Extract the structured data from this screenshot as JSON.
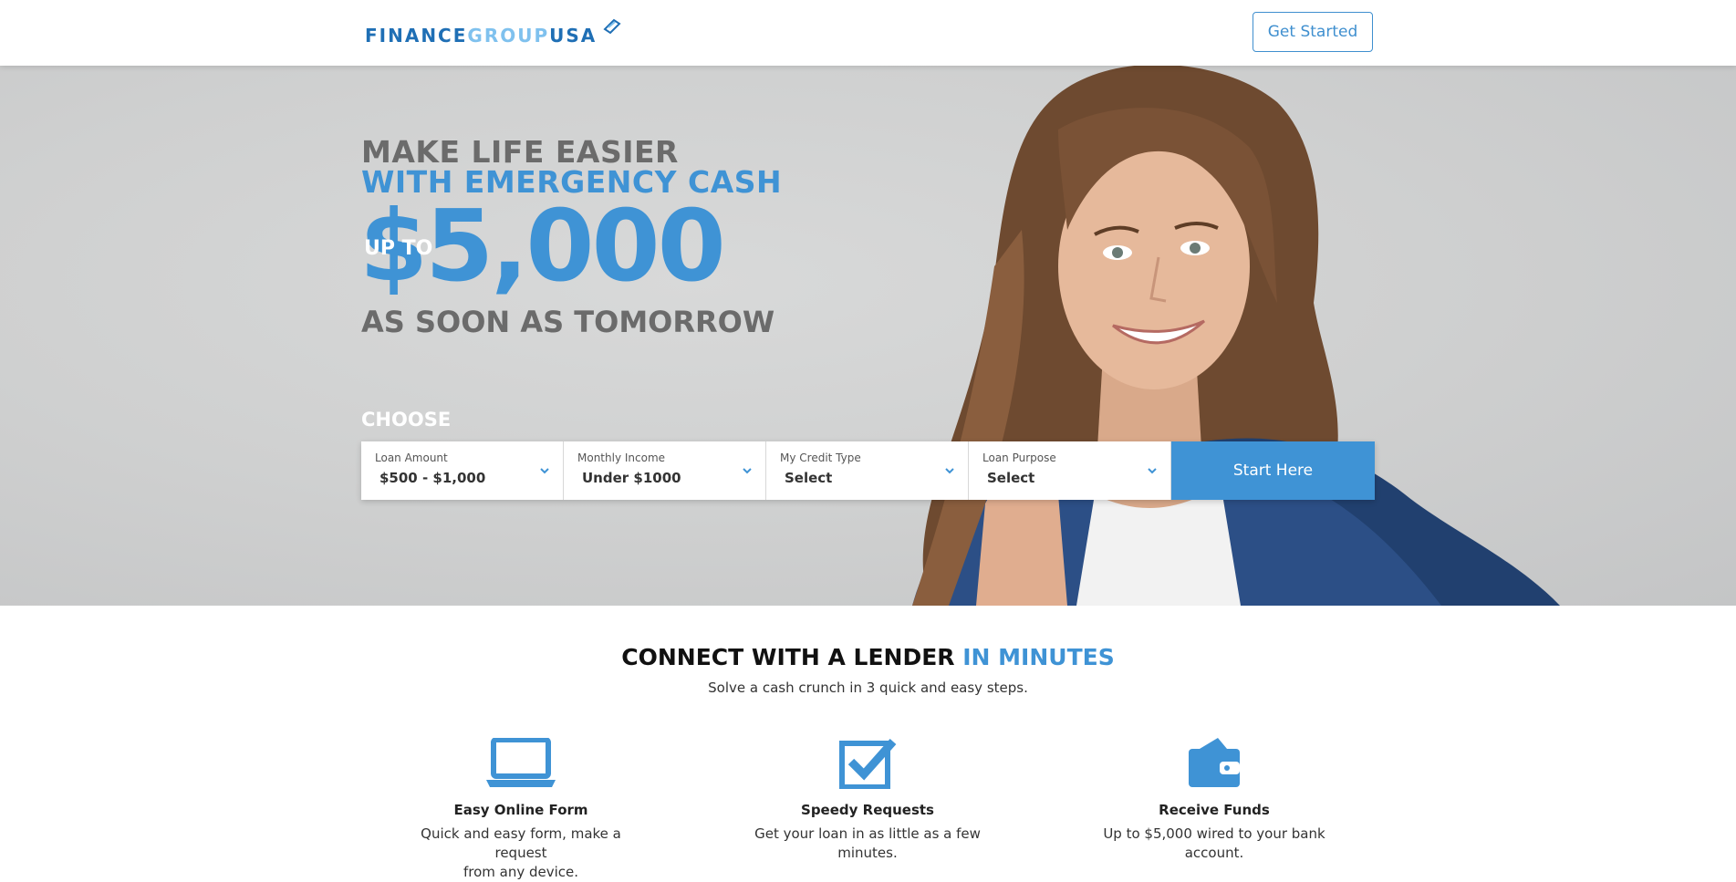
{
  "header": {
    "logo_part1": "FINANCE",
    "logo_part2": "GROUP",
    "logo_part3": "USA",
    "get_started_label": "Get Started"
  },
  "hero": {
    "line1": "MAKE LIFE EASIER",
    "line2": "WITH EMERGENCY CASH",
    "up_to": "UP TO",
    "amount": "$5,000",
    "line3": "AS SOON AS TOMORROW",
    "choose_label": "CHOOSE"
  },
  "form": {
    "fields": [
      {
        "label": "Loan Amount",
        "value": "$500 - $1,000"
      },
      {
        "label": "Monthly Income",
        "value": "Under $1000"
      },
      {
        "label": "My Credit Type",
        "value": "Select"
      },
      {
        "label": "Loan Purpose",
        "value": "Select"
      }
    ],
    "submit_label": "Start Here"
  },
  "section": {
    "title_part1": "CONNECT WITH A LENDER",
    "title_part2": "IN MINUTES",
    "subtitle": "Solve a cash crunch in 3 quick and easy steps.",
    "features": [
      {
        "icon": "laptop-icon",
        "title": "Easy Online Form",
        "desc_line1": "Quick and easy form, make a request",
        "desc_line2": "from any device."
      },
      {
        "icon": "checkbox-icon",
        "title": "Speedy Requests",
        "desc_line1": "Get your loan in as little as a few",
        "desc_line2": "minutes."
      },
      {
        "icon": "wallet-icon",
        "title": "Receive Funds",
        "desc_line1": "Up to $5,000 wired to your bank",
        "desc_line2": "account."
      }
    ]
  },
  "colors": {
    "accent": "#3f93d5",
    "logo_dark": "#1f6fb5",
    "logo_light": "#7fc1ee",
    "heading_gray": "#6b6b6b"
  }
}
